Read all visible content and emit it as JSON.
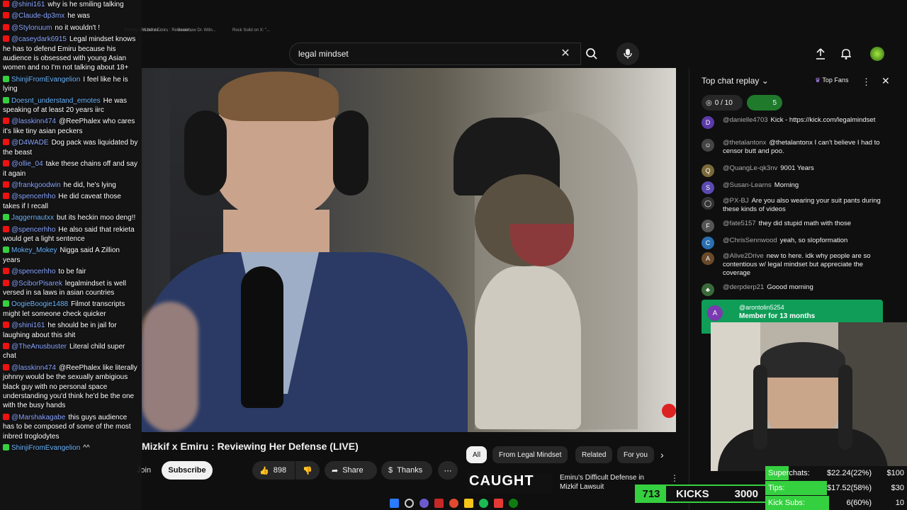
{
  "left_chat": [
    {
      "src": "yt",
      "user": "@shini161",
      "text": "why is he smiling talking"
    },
    {
      "src": "yt",
      "user": "@Claude-dp3mx",
      "text": "he was"
    },
    {
      "src": "yt",
      "user": "@Stylonuum",
      "text": "no it wouldn't !"
    },
    {
      "src": "yt",
      "user": "@caseydark6915",
      "text": "Legal mindset knows he has to defend Emiru because his audience is obsessed with young Asian women and no I'm not talking about 18+"
    },
    {
      "src": "kick",
      "user": "ShinjiFromEvangelion",
      "text": "I feel like he is lying"
    },
    {
      "src": "kick",
      "user": "Doesnt_understand_emotes",
      "text": "He was speaking of at least 20 years iirc"
    },
    {
      "src": "yt",
      "user": "@lasskinn474",
      "text": "@ReePhalex who cares it's like tiny asian peckers"
    },
    {
      "src": "yt",
      "user": "@D4WADE",
      "text": "Dog pack was liquidated by the beast"
    },
    {
      "src": "yt",
      "user": "@ollie_04",
      "text": "take these chains off and say it again"
    },
    {
      "src": "yt",
      "user": "@frankgoodwin",
      "text": "he did, he's lying"
    },
    {
      "src": "yt",
      "user": "@spencerhho",
      "text": "He did caveat those takes if I recall"
    },
    {
      "src": "kick",
      "user": "Jaggernautxx",
      "text": "but its heckin moo deng!!"
    },
    {
      "src": "yt",
      "user": "@spencerhho",
      "text": "He also said that rekieta would get a light sentence"
    },
    {
      "src": "kick",
      "user": "Mokey_Mokey",
      "text": "Nigga said A Zillion years"
    },
    {
      "src": "yt",
      "user": "@spencerhho",
      "text": "to be fair"
    },
    {
      "src": "yt",
      "user": "@SciborPisarek",
      "text": "legalmindset is well versed in sa laws in asian countries"
    },
    {
      "src": "kick",
      "user": "OogieBoogie1488",
      "text": "Filmot transcripts might let someone check quicker"
    },
    {
      "src": "yt",
      "user": "@shini161",
      "text": "he should be in jail for laughing about this shit"
    },
    {
      "src": "yt",
      "user": "@TheAnusbuster",
      "text": "Literal child super chat"
    },
    {
      "src": "yt",
      "user": "@lasskinn474",
      "text": "@ReePhalex like literally johnny would be the sexually ambigious black guy with no personal space understanding you'd think he'd be the one with the busy hands"
    },
    {
      "src": "yt",
      "user": "@Marshakagabe",
      "text": "this guys audience has to be composed of some of the most inbred troglodytes"
    },
    {
      "src": "kick",
      "user": "ShinjiFromEvangelion",
      "text": "^^"
    }
  ],
  "browser_tabs": [
    "Mizkif x Emiru : Reviewin...",
    "Tommy C is borde...",
    "Somehow Dr. Witn...",
    "Rock Solid on X: \"..."
  ],
  "search": {
    "value": "legal mindset"
  },
  "icons": {
    "clear": "✕",
    "search": "⌕",
    "mic": "🎤",
    "upload": "⇪",
    "bell": "🔔"
  },
  "video": {
    "title": "Mizkif x Emiru : Reviewing Her Defense (LIVE)"
  },
  "actions": {
    "join": "Join",
    "subscribe": "Subscribe",
    "likes": "898",
    "share": "Share",
    "thanks": "Thanks"
  },
  "chips": [
    "All",
    "From Legal Mindset",
    "Related",
    "For you"
  ],
  "recommendation": {
    "thumb_text": "CAUGHT",
    "title": "Emiru's Difficult Defense in Mizkif Lawsuit"
  },
  "right_chat": {
    "header": "Top chat replay",
    "top_fans": "Top Fans",
    "goal": "0 / 10",
    "count": "5",
    "messages": [
      {
        "user": "@danielle4703",
        "text": "Kick - https://kick.com/legalmindset",
        "avatar": "D",
        "color": "#5b3aa8"
      },
      {
        "user": "@thetalantonx",
        "text": "@thetalantonx I can't believe I had to censor butt and poo.",
        "avatar": "☺",
        "color": "#444"
      },
      {
        "user": "@QuangLe-qk3nv",
        "text": "9001 Years",
        "avatar": "Q",
        "color": "#7a6a3a"
      },
      {
        "user": "@Susan-Learns",
        "text": "Morning",
        "avatar": "S",
        "color": "#5a4ab0"
      },
      {
        "user": "@PX-BJ",
        "text": "Are you also wearing your suit pants during these kinds of videos",
        "avatar": "◯",
        "color": "#333"
      },
      {
        "user": "@fate5157",
        "text": "they did stupid math with those",
        "avatar": "F",
        "color": "#555"
      },
      {
        "user": "@ChrisSennwood",
        "text": "yeah, so slopformation",
        "avatar": "C",
        "color": "#2a6fb0"
      },
      {
        "user": "@Alive2Drive",
        "text": "new to here. idk why people are so contentious w/ legal mindset but appreciate the coverage",
        "avatar": "A",
        "color": "#6a4a2a"
      },
      {
        "user": "@derpderp21",
        "text": "Goood morning",
        "avatar": "♣",
        "color": "#3a6a3a"
      }
    ],
    "member": {
      "user": "@arontolin5254",
      "text": "Member for 13 months"
    }
  },
  "kicks": {
    "count": "713",
    "label": "KICKS",
    "goal": "3000"
  },
  "stats": [
    {
      "label": "Superchats:",
      "value": "$22.24(22%)",
      "goal": "$100",
      "fill": 0.22
    },
    {
      "label": "Tips:",
      "value": "$17.52(58%)",
      "goal": "$30",
      "fill": 0.58
    },
    {
      "label": "Kick Subs:",
      "value": "6(60%)",
      "goal": "10",
      "fill": 0.6
    }
  ]
}
